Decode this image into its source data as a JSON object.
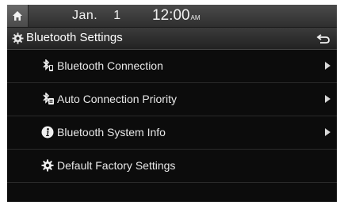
{
  "status_bar": {
    "date_month": "Jan.",
    "date_day": "1",
    "time": "12:00",
    "ampm": "AM"
  },
  "title_bar": {
    "title": "Bluetooth Settings"
  },
  "menu": {
    "items": [
      {
        "label": "Bluetooth Connection",
        "icon": "bluetooth-phone-icon",
        "has_arrow": true
      },
      {
        "label": "Auto Connection Priority",
        "icon": "bluetooth-priority-icon",
        "has_arrow": true
      },
      {
        "label": "Bluetooth System Info",
        "icon": "info-icon",
        "has_arrow": true
      },
      {
        "label": "Default Factory Settings",
        "icon": "gear-icon",
        "has_arrow": false
      }
    ]
  },
  "colors": {
    "background": "#0c0c0c",
    "text": "#e8e8e8",
    "status_bar": "#3a3a3a"
  }
}
